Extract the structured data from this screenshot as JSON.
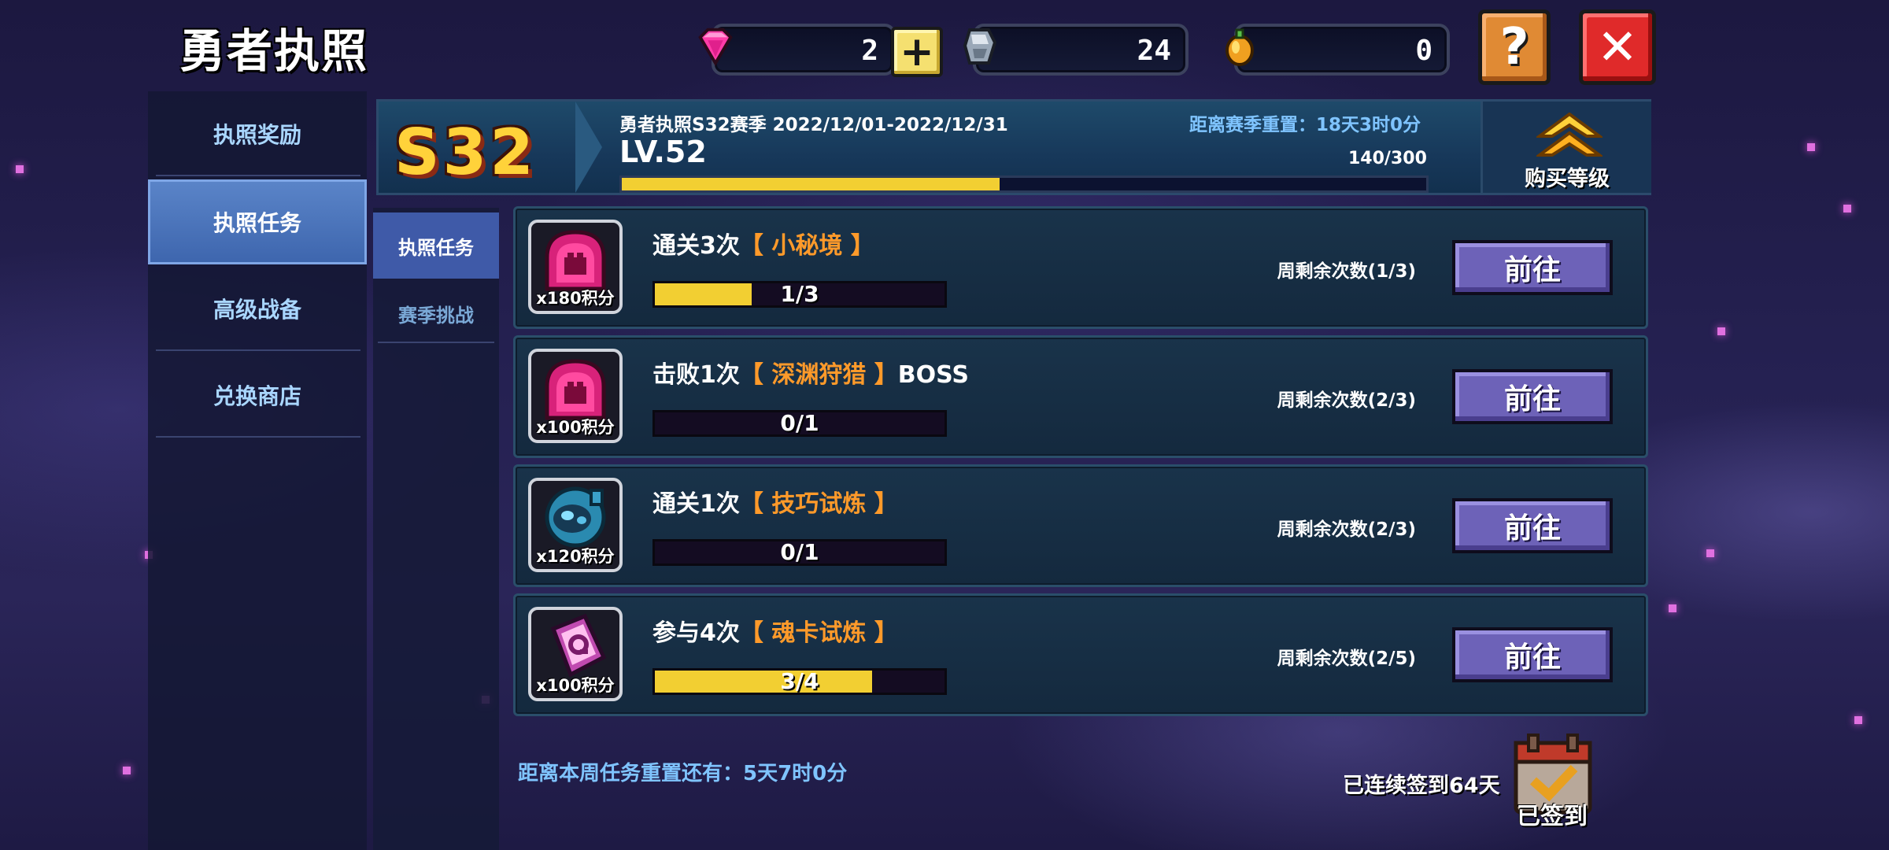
{
  "title": "勇者执照",
  "currencies": [
    {
      "icon": "pink-gem-icon",
      "value": "2"
    },
    {
      "icon": "silver-ore-icon",
      "value": "24"
    },
    {
      "icon": "gold-seed-icon",
      "value": "0"
    }
  ],
  "left_nav": [
    {
      "label": "执照奖励",
      "active": false
    },
    {
      "label": "执照任务",
      "active": true
    },
    {
      "label": "高级战备",
      "active": false
    },
    {
      "label": "兑换商店",
      "active": false
    }
  ],
  "sub_nav": [
    {
      "label": "执照任务",
      "active": true
    },
    {
      "label": "赛季挑战",
      "active": false
    }
  ],
  "season": {
    "logo": "S32",
    "title": "勇者执照S32赛季 2022/12/01-2022/12/31",
    "reset_text": "距离赛季重置：18天3时0分",
    "level": "LV.52",
    "exp": "140/300",
    "progress": 0.47,
    "buy_label": "购买等级"
  },
  "tasks": [
    {
      "prefix": "通关3次",
      "highlight": "【 小秘境 】",
      "suffix": "",
      "points": "x180积分",
      "icon": "pink-monster-icon",
      "progress_text": "1/3",
      "progress": 0.333,
      "remaining": "周剩余次数(1/3)",
      "button": "前往"
    },
    {
      "prefix": "击败1次",
      "highlight": "【 深渊狩猎 】",
      "suffix": "BOSS",
      "points": "x100积分",
      "icon": "pink-monster-icon",
      "progress_text": "0/1",
      "progress": 0,
      "remaining": "周剩余次数(2/3)",
      "button": "前往"
    },
    {
      "prefix": "通关1次",
      "highlight": "【 技巧试炼 】",
      "suffix": "",
      "points": "x120积分",
      "icon": "blue-robot-icon",
      "progress_text": "0/1",
      "progress": 0,
      "remaining": "周剩余次数(2/3)",
      "button": "前往"
    },
    {
      "prefix": "参与4次",
      "highlight": "【 魂卡试炼 】",
      "suffix": "",
      "points": "x100积分",
      "icon": "soul-card-icon",
      "progress_text": "3/4",
      "progress": 0.75,
      "remaining": "周剩余次数(2/5)",
      "button": "前往"
    }
  ],
  "weekly_reset": "距离本周任务重置还有：5天7时0分",
  "checkin": {
    "label": "已连续签到64天",
    "status": "已签到"
  },
  "colors": {
    "accent_yellow": "#f2cf32",
    "highlight_orange": "#ff9a2a",
    "button_purple": "#6d62b8",
    "nav_active": "#4a72bc"
  }
}
